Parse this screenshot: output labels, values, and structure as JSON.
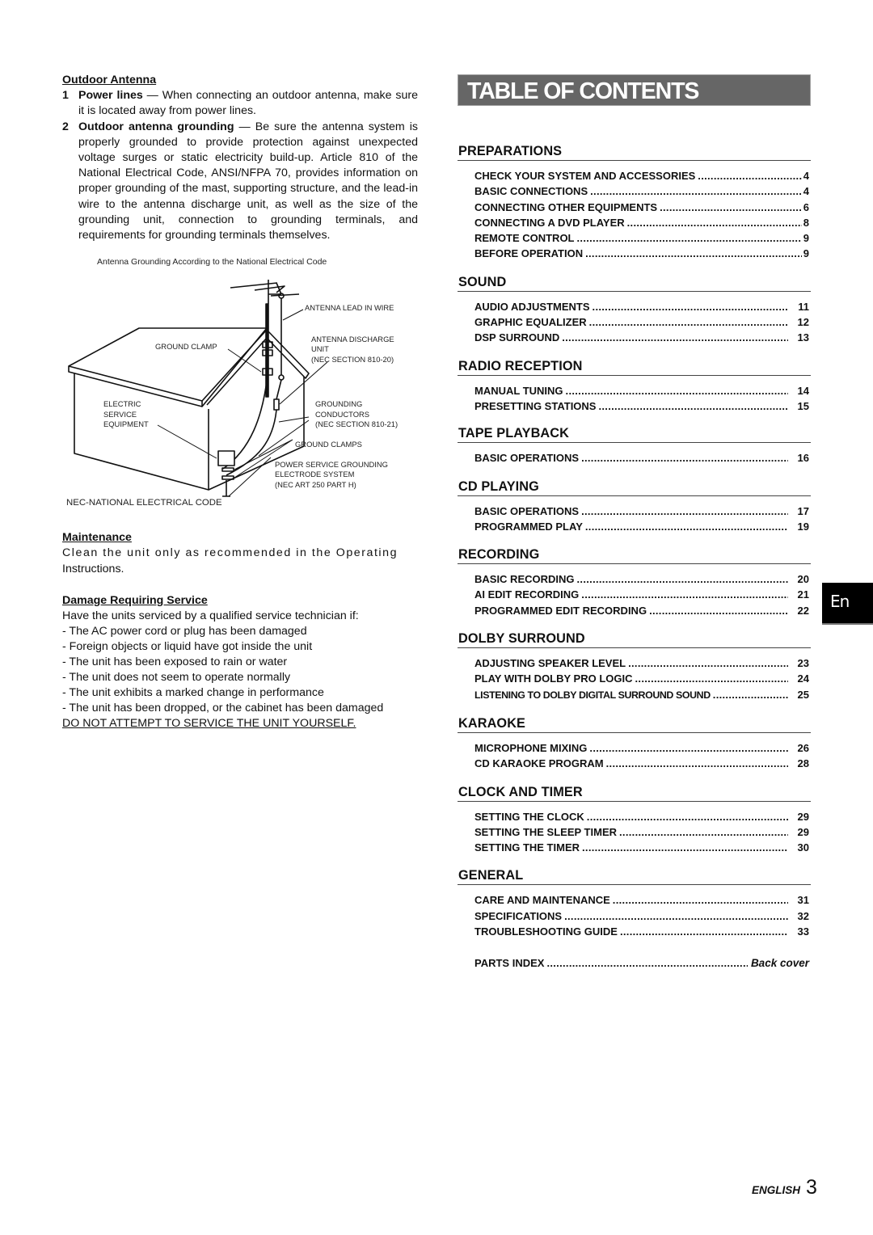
{
  "left": {
    "outdoor_antenna": {
      "heading": "Outdoor Antenna",
      "items": [
        {
          "num": "1",
          "bold": "Power lines",
          "text": " — When connecting an outdoor antenna, make sure it is located away from power lines."
        },
        {
          "num": "2",
          "bold": "Outdoor antenna grounding",
          "text": " — Be sure the antenna system is properly grounded to provide protection against unexpected voltage surges or static electricity build-up. Article 810 of the National Electrical Code, ANSI/NFPA 70, provides information on proper grounding of the mast, supporting structure, and the lead-in wire to the antenna discharge unit, as well as the size of the grounding unit, connection to grounding terminals, and requirements for grounding terminals themselves."
        }
      ]
    },
    "figure": {
      "caption": "Antenna Grounding According to the National Electrical Code",
      "labels": {
        "antenna_lead_in_wire": "ANTENNA LEAD IN WIRE",
        "ground_clamp": "GROUND CLAMP",
        "antenna_discharge_1": "ANTENNA DISCHARGE",
        "antenna_discharge_2": "UNIT",
        "antenna_discharge_3": "(NEC SECTION 810-20)",
        "electric_1": "ELECTRIC",
        "electric_2": "SERVICE",
        "electric_3": "EQUIPMENT",
        "grounding_1": "GROUNDING",
        "grounding_2": "CONDUCTORS",
        "grounding_3": "(NEC SECTION 810-21)",
        "ground_clamps": "GROUND CLAMPS",
        "power_1": "POWER SERVICE GROUNDING",
        "power_2": "ELECTRODE SYSTEM",
        "power_3": "(NEC ART 250 PART H)"
      },
      "footnote": "NEC-NATIONAL ELECTRICAL CODE"
    },
    "maintenance": {
      "heading": "Maintenance",
      "line1": "Clean the unit only as recommended in the Operating",
      "line2": "Instructions."
    },
    "damage": {
      "heading": "Damage Requiring Service",
      "intro": "Have the units serviced by a qualified service technician if:",
      "items": [
        "- The AC power cord or plug has been damaged",
        "- Foreign objects or liquid have got inside the unit",
        "- The unit has been exposed to rain or water",
        "- The unit does not seem to operate normally",
        "- The unit exhibits a marked change in performance",
        "- The unit has been dropped, or the cabinet has been damaged"
      ],
      "warning": "DO NOT ATTEMPT TO SERVICE THE UNIT YOURSELF."
    }
  },
  "toc": {
    "title": "TABLE OF CONTENTS",
    "sections": [
      {
        "title": "PREPARATIONS",
        "entries": [
          {
            "label": "CHECK YOUR SYSTEM AND ACCESSORIES",
            "page": "4"
          },
          {
            "label": "BASIC CONNECTIONS",
            "page": "4"
          },
          {
            "label": "CONNECTING OTHER EQUIPMENTS",
            "page": "6"
          },
          {
            "label": "CONNECTING A DVD PLAYER",
            "page": "8"
          },
          {
            "label": "REMOTE CONTROL",
            "page": "9"
          },
          {
            "label": "BEFORE OPERATION",
            "page": "9"
          }
        ]
      },
      {
        "title": "SOUND",
        "entries": [
          {
            "label": "AUDIO ADJUSTMENTS",
            "page": "11"
          },
          {
            "label": "GRAPHIC EQUALIZER",
            "page": "12"
          },
          {
            "label": "DSP SURROUND",
            "page": "13"
          }
        ]
      },
      {
        "title": "RADIO RECEPTION",
        "entries": [
          {
            "label": "MANUAL TUNING",
            "page": "14"
          },
          {
            "label": "PRESETTING STATIONS",
            "page": "15"
          }
        ]
      },
      {
        "title": "TAPE PLAYBACK",
        "entries": [
          {
            "label": "BASIC OPERATIONS",
            "page": "16"
          }
        ]
      },
      {
        "title": "CD PLAYING",
        "entries": [
          {
            "label": "BASIC OPERATIONS",
            "page": "17"
          },
          {
            "label": "PROGRAMMED PLAY",
            "page": "19"
          }
        ]
      },
      {
        "title": "RECORDING",
        "entries": [
          {
            "label": "BASIC RECORDING",
            "page": "20"
          },
          {
            "label": "AI EDIT RECORDING",
            "page": "21"
          },
          {
            "label": "PROGRAMMED EDIT RECORDING",
            "page": "22"
          }
        ]
      },
      {
        "title": "DOLBY SURROUND",
        "entries": [
          {
            "label": "ADJUSTING SPEAKER LEVEL",
            "page": "23"
          },
          {
            "label": "PLAY WITH DOLBY PRO LOGIC",
            "page": "24"
          },
          {
            "label": "LISTENING TO DOLBY DIGITAL SURROUND SOUND",
            "page": "25"
          }
        ]
      },
      {
        "title": "KARAOKE",
        "entries": [
          {
            "label": "MICROPHONE MIXING",
            "page": "26"
          },
          {
            "label": "CD KARAOKE PROGRAM",
            "page": "28"
          }
        ]
      },
      {
        "title": "CLOCK AND TIMER",
        "entries": [
          {
            "label": "SETTING THE CLOCK",
            "page": "29"
          },
          {
            "label": "SETTING THE SLEEP TIMER",
            "page": "29"
          },
          {
            "label": "SETTING THE TIMER",
            "page": "30"
          }
        ]
      },
      {
        "title": "GENERAL",
        "entries": [
          {
            "label": "CARE AND MAINTENANCE",
            "page": "31"
          },
          {
            "label": "SPECIFICATIONS",
            "page": "32"
          },
          {
            "label": "TROUBLESHOOTING GUIDE",
            "page": "33"
          }
        ]
      }
    ],
    "parts_index": {
      "label": "PARTS INDEX",
      "page": "Back cover"
    }
  },
  "language_tab": "En",
  "footer": {
    "language": "ENGLISH",
    "page_number": "3"
  },
  "colors": {
    "title_bar": "#666666",
    "lang_tab": "#000000"
  }
}
